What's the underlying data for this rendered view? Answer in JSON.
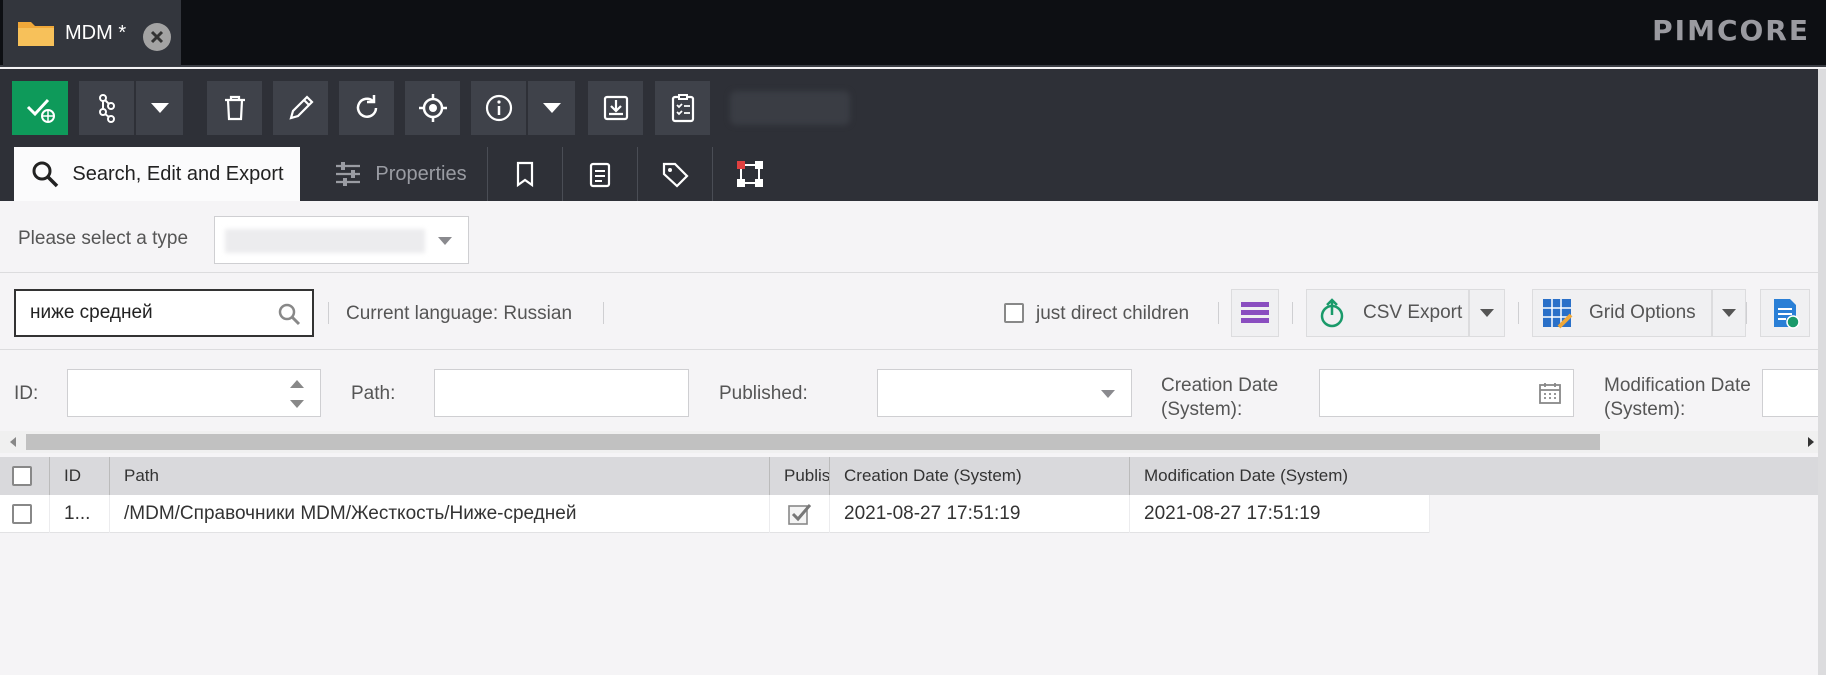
{
  "tab": {
    "title": "MDM *"
  },
  "logo": "PIMCORE",
  "subtabs": {
    "search_label": "Search, Edit and Export",
    "properties_label": "Properties"
  },
  "typebar": {
    "label": "Please select a type"
  },
  "search": {
    "value": "ниже средней"
  },
  "current_language": "Current language: Russian",
  "just_direct_children": "just direct children",
  "buttons": {
    "csv_export": "CSV Export",
    "grid_options": "Grid Options"
  },
  "filters": {
    "id": "ID:",
    "path": "Path:",
    "published": "Published:",
    "creation_date": "Creation Date (System):",
    "modification_date": "Modification Date (System):"
  },
  "grid": {
    "columns": [
      "ID",
      "Path",
      "Publis",
      "Creation Date (System)",
      "Modification Date (System)"
    ],
    "rows": [
      {
        "id": "1...",
        "path": "/MDM/Справочники MDM/Жесткость/Ниже-средней",
        "published": true,
        "creation_date": "2021-08-27 17:51:19",
        "modification_date": "2021-08-27 17:51:19"
      }
    ]
  },
  "colors": {
    "green": "#0e9a5a",
    "toolbar": "#2e3037",
    "topbar": "#0d0f13"
  }
}
